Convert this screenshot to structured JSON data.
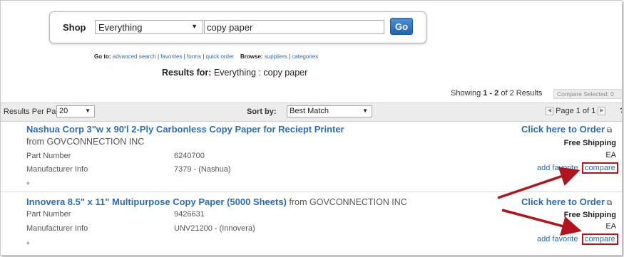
{
  "search": {
    "shop_label": "Shop",
    "scope_value": "Everything",
    "query_value": "copy paper",
    "go_label": "Go"
  },
  "goto": {
    "label": "Go to:",
    "links": [
      "advanced search",
      "favorites",
      "forms",
      "quick order"
    ],
    "browse_label": "Browse:",
    "browse_links": [
      "suppliers",
      "categories"
    ]
  },
  "results_for": {
    "label": "Results for:",
    "value": "Everything : copy paper"
  },
  "showing": {
    "prefix": "Showing",
    "range": "1 - 2",
    "suffix": "of 2 Results",
    "compare_selected": "Compare Selected: 0"
  },
  "toolbar": {
    "rpp_label": "Results Per Page",
    "rpp_value": "20",
    "sort_label": "Sort by:",
    "sort_value": "Best Match",
    "page_text": "Page 1 of 1",
    "help": "?"
  },
  "results": [
    {
      "title": "Nashua Corp 3\"w x 90'l 2-Ply Carbonless Copy Paper for Reciept Printer",
      "from": "from GOVCONNECTION INC",
      "part_label": "Part Number",
      "part_value": "6240700",
      "mfr_label": "Manufacturer Info",
      "mfr_value": "7379 - (Nashua)",
      "order_label": "Click here to Order",
      "shipping": "Free Shipping",
      "uom": "EA",
      "favorite": "add favorite",
      "compare": "compare"
    },
    {
      "title": "Innovera 8.5\" x 11\" Multipurpose Copy Paper (5000 Sheets)",
      "from": "from GOVCONNECTION INC",
      "part_label": "Part Number",
      "part_value": "9426631",
      "mfr_label": "Manufacturer Info",
      "mfr_value": "UNV21200 - (Innovera)",
      "order_label": "Click here to Order",
      "shipping": "Free Shipping",
      "uom": "EA",
      "favorite": "add favorite",
      "compare": "compare"
    }
  ],
  "colors": {
    "link": "#2a6db9",
    "highlight": "#b0141c",
    "go_button": "#2f75c4"
  }
}
